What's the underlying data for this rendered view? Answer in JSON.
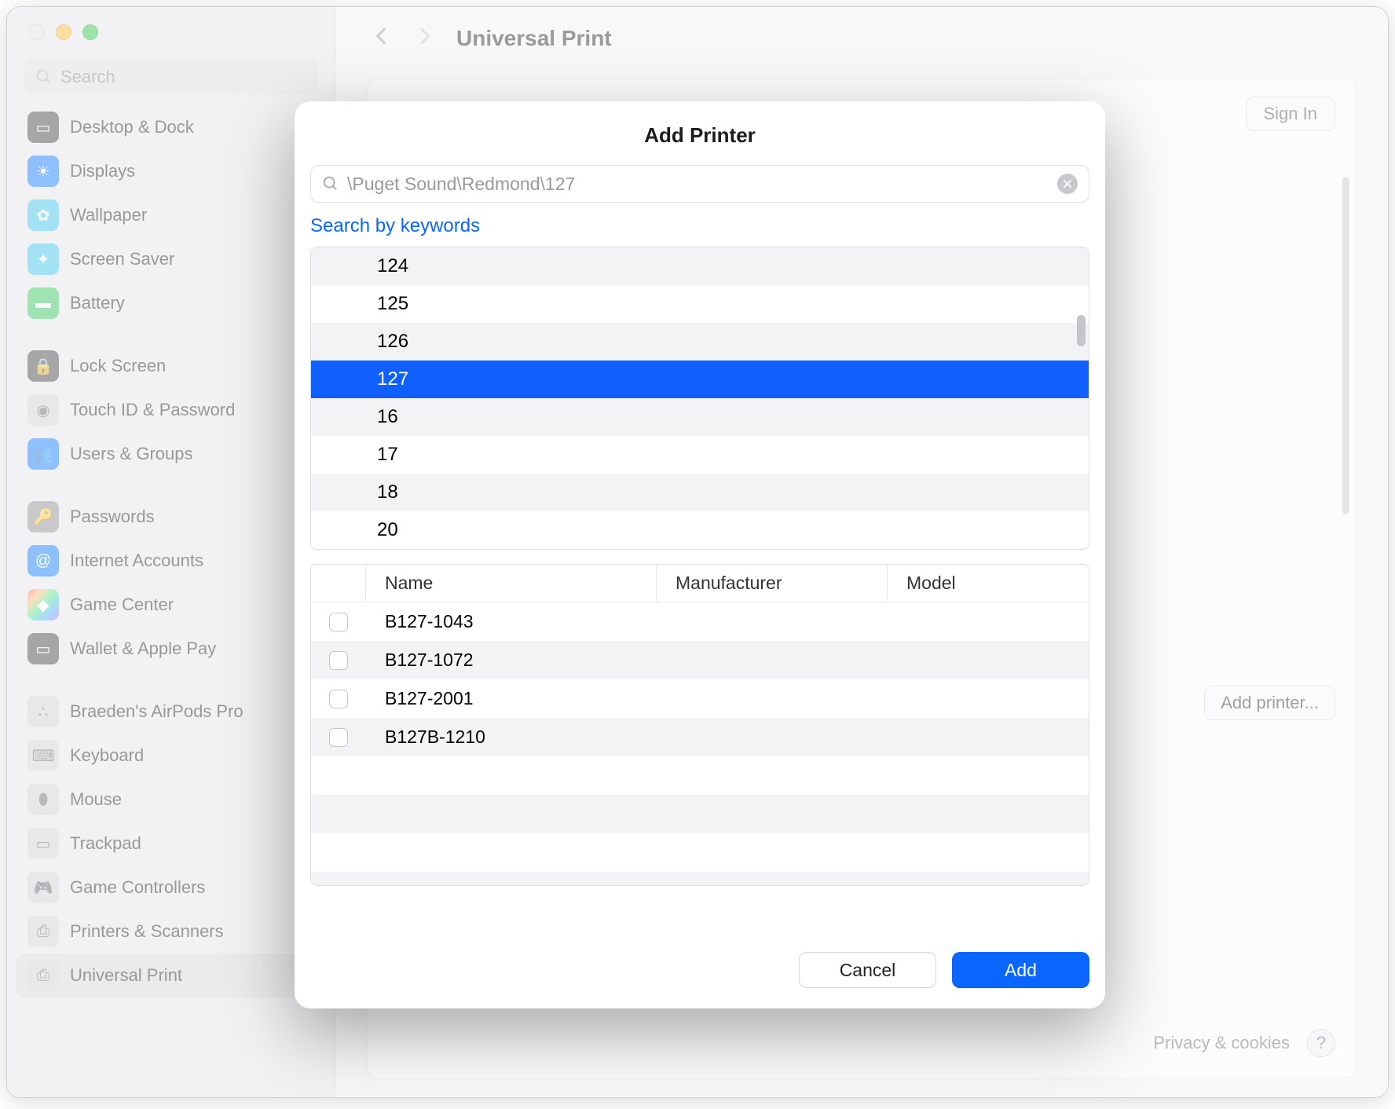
{
  "window": {
    "title": "Universal Print",
    "search_placeholder": "Search"
  },
  "sidebar": {
    "groups": [
      {
        "items": [
          {
            "label": "Desktop & Dock",
            "icon_name": "dock-icon",
            "color": "c-dark"
          },
          {
            "label": "Displays",
            "icon_name": "sun-icon",
            "color": "c-blue"
          },
          {
            "label": "Wallpaper",
            "icon_name": "flower-icon",
            "color": "c-teal"
          },
          {
            "label": "Screen Saver",
            "icon_name": "sparkle-icon",
            "color": "c-teal"
          },
          {
            "label": "Battery",
            "icon_name": "battery-icon",
            "color": "c-green"
          }
        ]
      },
      {
        "items": [
          {
            "label": "Lock Screen",
            "icon_name": "lock-icon",
            "color": "c-dark"
          },
          {
            "label": "Touch ID & Password",
            "icon_name": "fingerprint-icon",
            "color": "c-light"
          },
          {
            "label": "Users & Groups",
            "icon_name": "users-icon",
            "color": "c-blue"
          }
        ]
      },
      {
        "items": [
          {
            "label": "Passwords",
            "icon_name": "key-icon",
            "color": "c-grey"
          },
          {
            "label": "Internet Accounts",
            "icon_name": "at-icon",
            "color": "c-blue"
          },
          {
            "label": "Game Center",
            "icon_name": "game-icon",
            "color": "c-rainbow"
          },
          {
            "label": "Wallet & Apple Pay",
            "icon_name": "wallet-icon",
            "color": "c-dark"
          }
        ]
      },
      {
        "items": [
          {
            "label": "Braeden's AirPods Pro",
            "icon_name": "airpods-icon",
            "color": "c-light"
          },
          {
            "label": "Keyboard",
            "icon_name": "keyboard-icon",
            "color": "c-light"
          },
          {
            "label": "Mouse",
            "icon_name": "mouse-icon",
            "color": "c-light"
          },
          {
            "label": "Trackpad",
            "icon_name": "trackpad-icon",
            "color": "c-light"
          },
          {
            "label": "Game Controllers",
            "icon_name": "controller-icon",
            "color": "c-light"
          },
          {
            "label": "Printers & Scanners",
            "icon_name": "printer-icon",
            "color": "c-light"
          },
          {
            "label": "Universal Print",
            "icon_name": "universal-print-icon",
            "color": "c-light",
            "active": true
          }
        ]
      }
    ]
  },
  "main": {
    "sign_in": "Sign In",
    "add_printer": "Add printer...",
    "footer_link": "Privacy & cookies",
    "help": "?"
  },
  "dialog": {
    "title": "Add Printer",
    "search_value": "\\Puget Sound\\Redmond\\127",
    "keywords_link": "Search by keywords",
    "locations": [
      {
        "label": "124"
      },
      {
        "label": "125"
      },
      {
        "label": "126"
      },
      {
        "label": "127",
        "selected": true
      },
      {
        "label": "16"
      },
      {
        "label": "17"
      },
      {
        "label": "18"
      },
      {
        "label": "20"
      }
    ],
    "table": {
      "headers": {
        "name": "Name",
        "manufacturer": "Manufacturer",
        "model": "Model"
      },
      "rows": [
        {
          "name": "B127-1043",
          "manufacturer": "",
          "model": ""
        },
        {
          "name": "B127-1072",
          "manufacturer": "",
          "model": ""
        },
        {
          "name": "B127-2001",
          "manufacturer": "",
          "model": ""
        },
        {
          "name": "B127B-1210",
          "manufacturer": "",
          "model": ""
        }
      ]
    },
    "buttons": {
      "cancel": "Cancel",
      "add": "Add"
    }
  }
}
